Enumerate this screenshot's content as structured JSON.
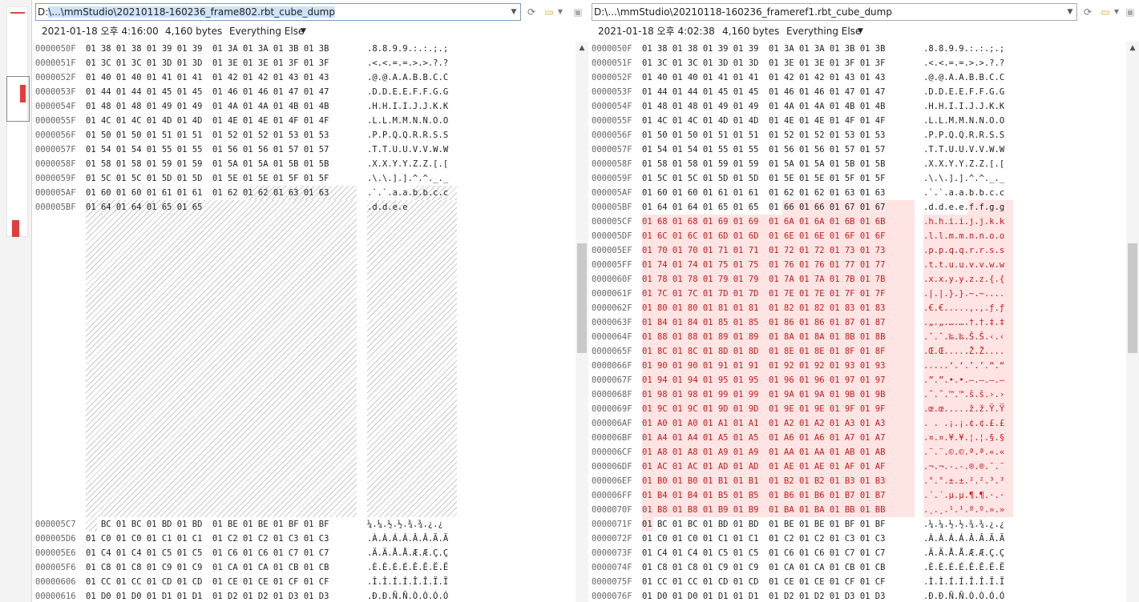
{
  "left_pane": {
    "path": "D:\\...\\mmStudio\\20210118-160236_frame802.rbt_cube_dump",
    "path_prefix": "D:",
    "path_rest": "\\...\\mmStudio\\20210118-160236_frame802.rbt_cube_dump",
    "date": "2021-01-18 오후 4:16:00",
    "size": "4,160 bytes",
    "filter": "Everything Else",
    "rows_top": [
      {
        "addr": "0000050F",
        "bytes": "01 38 01 38 01 39 01 39  01 3A 01 3A 01 3B 01 3B",
        "ascii": ".8.8.9.9.:.:.;.;"
      },
      {
        "addr": "0000051F",
        "bytes": "01 3C 01 3C 01 3D 01 3D  01 3E 01 3E 01 3F 01 3F",
        "ascii": ".<.<.=.=.>.>.?.?"
      },
      {
        "addr": "0000052F",
        "bytes": "01 40 01 40 01 41 01 41  01 42 01 42 01 43 01 43",
        "ascii": ".@.@.A.A.B.B.C.C"
      },
      {
        "addr": "0000053F",
        "bytes": "01 44 01 44 01 45 01 45  01 46 01 46 01 47 01 47",
        "ascii": ".D.D.E.E.F.F.G.G"
      },
      {
        "addr": "0000054F",
        "bytes": "01 48 01 48 01 49 01 49  01 4A 01 4A 01 4B 01 4B",
        "ascii": ".H.H.I.I.J.J.K.K"
      },
      {
        "addr": "0000055F",
        "bytes": "01 4C 01 4C 01 4D 01 4D  01 4E 01 4E 01 4F 01 4F",
        "ascii": ".L.L.M.M.N.N.O.O"
      },
      {
        "addr": "0000056F",
        "bytes": "01 50 01 50 01 51 01 51  01 52 01 52 01 53 01 53",
        "ascii": ".P.P.Q.Q.R.R.S.S"
      },
      {
        "addr": "0000057F",
        "bytes": "01 54 01 54 01 55 01 55  01 56 01 56 01 57 01 57",
        "ascii": ".T.T.U.U.V.V.W.W"
      },
      {
        "addr": "0000058F",
        "bytes": "01 58 01 58 01 59 01 59  01 5A 01 5A 01 5B 01 5B",
        "ascii": ".X.X.Y.Y.Z.Z.[.["
      },
      {
        "addr": "0000059F",
        "bytes": "01 5C 01 5C 01 5D 01 5D  01 5E 01 5E 01 5F 01 5F",
        "ascii": ".\\.\\.].].^.^._._"
      },
      {
        "addr": "000005AF",
        "bytes": "01 60 01 60 01 61 01 61  01 62 01 62 01 63 01 63",
        "ascii": ".`.`.a.a.b.b.c.c"
      },
      {
        "addr": "000005BF",
        "bytes": "01 64 01 64 01 65 01 65",
        "ascii": ".d.d.e.e"
      }
    ],
    "rows_bottom": [
      {
        "addr": "000005C7",
        "bytes": "   BC 01 BC 01 BD 01 BD  01 BE 01 BE 01 BF 01 BF",
        "ascii": "¼.¼.½.½.¾.¾.¿.¿"
      },
      {
        "addr": "000005D6",
        "bytes": "01 C0 01 C0 01 C1 01 C1  01 C2 01 C2 01 C3 01 C3",
        "ascii": ".À.À.Á.Á.Â.Â.Ã.Ã"
      },
      {
        "addr": "000005E6",
        "bytes": "01 C4 01 C4 01 C5 01 C5  01 C6 01 C6 01 C7 01 C7",
        "ascii": ".Ä.Ä.Å.Å.Æ.Æ.Ç.Ç"
      },
      {
        "addr": "000005F6",
        "bytes": "01 C8 01 C8 01 C9 01 C9  01 CA 01 CA 01 CB 01 CB",
        "ascii": ".È.È.É.É.Ê.Ê.Ë.Ë"
      },
      {
        "addr": "00000606",
        "bytes": "01 CC 01 CC 01 CD 01 CD  01 CE 01 CE 01 CF 01 CF",
        "ascii": ".Ì.Ì.Í.Í.Î.Î.Ï.Ï"
      },
      {
        "addr": "00000616",
        "bytes": "01 D0 01 D0 01 D1 01 D1  01 D2 01 D2 01 D3 01 D3",
        "ascii": ".Ð.Ð.Ñ.Ñ.Ò.Ò.Ó.Ó"
      }
    ]
  },
  "right_pane": {
    "path": "D:\\...\\mmStudio\\20210118-160236_frameref1.rbt_cube_dump",
    "date": "2021-01-18 오후 4:02:38",
    "size": "4,160 bytes",
    "filter": "Everything Else",
    "rows": [
      {
        "addr": "0000050F",
        "bytes": "01 38 01 38 01 39 01 39  01 3A 01 3A 01 3B 01 3B",
        "ascii": ".8.8.9.9.:.:.;.;",
        "diff": false
      },
      {
        "addr": "0000051F",
        "bytes": "01 3C 01 3C 01 3D 01 3D  01 3E 01 3E 01 3F 01 3F",
        "ascii": ".<.<.=.=.>.>.?.?",
        "diff": false
      },
      {
        "addr": "0000052F",
        "bytes": "01 40 01 40 01 41 01 41  01 42 01 42 01 43 01 43",
        "ascii": ".@.@.A.A.B.B.C.C",
        "diff": false
      },
      {
        "addr": "0000053F",
        "bytes": "01 44 01 44 01 45 01 45  01 46 01 46 01 47 01 47",
        "ascii": ".D.D.E.E.F.F.G.G",
        "diff": false
      },
      {
        "addr": "0000054F",
        "bytes": "01 48 01 48 01 49 01 49  01 4A 01 4A 01 4B 01 4B",
        "ascii": ".H.H.I.I.J.J.K.K",
        "diff": false
      },
      {
        "addr": "0000055F",
        "bytes": "01 4C 01 4C 01 4D 01 4D  01 4E 01 4E 01 4F 01 4F",
        "ascii": ".L.L.M.M.N.N.O.O",
        "diff": false
      },
      {
        "addr": "0000056F",
        "bytes": "01 50 01 50 01 51 01 51  01 52 01 52 01 53 01 53",
        "ascii": ".P.P.Q.Q.R.R.S.S",
        "diff": false
      },
      {
        "addr": "0000057F",
        "bytes": "01 54 01 54 01 55 01 55  01 56 01 56 01 57 01 57",
        "ascii": ".T.T.U.U.V.V.W.W",
        "diff": false
      },
      {
        "addr": "0000058F",
        "bytes": "01 58 01 58 01 59 01 59  01 5A 01 5A 01 5B 01 5B",
        "ascii": ".X.X.Y.Y.Z.Z.[.[",
        "diff": false
      },
      {
        "addr": "0000059F",
        "bytes": "01 5C 01 5C 01 5D 01 5D  01 5E 01 5E 01 5F 01 5F",
        "ascii": ".\\.\\.].].^.^._._",
        "diff": false
      },
      {
        "addr": "000005AF",
        "bytes": "01 60 01 60 01 61 01 61  01 62 01 62 01 63 01 63",
        "ascii": ".`.`.a.a.b.b.c.c",
        "diff": false
      },
      {
        "addr": "000005BF",
        "bytes": "01 64 01 64 01 65 01 65  01 66 01 66 01 67 01 67",
        "ascii": ".d.d.e.e.f.f.g.g",
        "diff": "partial"
      },
      {
        "addr": "000005CF",
        "bytes": "01 68 01 68 01 69 01 69  01 6A 01 6A 01 6B 01 6B",
        "ascii": ".h.h.i.i.j.j.k.k",
        "diff": true
      },
      {
        "addr": "000005DF",
        "bytes": "01 6C 01 6C 01 6D 01 6D  01 6E 01 6E 01 6F 01 6F",
        "ascii": ".l.l.m.m.n.n.o.o",
        "diff": true
      },
      {
        "addr": "000005EF",
        "bytes": "01 70 01 70 01 71 01 71  01 72 01 72 01 73 01 73",
        "ascii": ".p.p.q.q.r.r.s.s",
        "diff": true
      },
      {
        "addr": "000005FF",
        "bytes": "01 74 01 74 01 75 01 75  01 76 01 76 01 77 01 77",
        "ascii": ".t.t.u.u.v.v.w.w",
        "diff": true
      },
      {
        "addr": "0000060F",
        "bytes": "01 78 01 78 01 79 01 79  01 7A 01 7A 01 7B 01 7B",
        "ascii": ".x.x.y.y.z.z.{.{",
        "diff": true
      },
      {
        "addr": "0000061F",
        "bytes": "01 7C 01 7C 01 7D 01 7D  01 7E 01 7E 01 7F 01 7F",
        "ascii": ".|.|.}.}.~.~....",
        "diff": true
      },
      {
        "addr": "0000062F",
        "bytes": "01 80 01 80 01 81 01 81  01 82 01 82 01 83 01 83",
        "ascii": ".€.€.....‚.‚.ƒ.ƒ",
        "diff": true
      },
      {
        "addr": "0000063F",
        "bytes": "01 84 01 84 01 85 01 85  01 86 01 86 01 87 01 87",
        "ascii": ".„.„.….….†.†.‡.‡",
        "diff": true
      },
      {
        "addr": "0000064F",
        "bytes": "01 88 01 88 01 89 01 89  01 8A 01 8A 01 8B 01 8B",
        "ascii": ".ˆ.ˆ.‰.‰.Š.Š.‹.‹",
        "diff": true
      },
      {
        "addr": "0000065F",
        "bytes": "01 8C 01 8C 01 8D 01 8D  01 8E 01 8E 01 8F 01 8F",
        "ascii": ".Œ.Œ.....Ž.Ž....",
        "diff": true
      },
      {
        "addr": "0000066F",
        "bytes": "01 90 01 90 01 91 01 91  01 92 01 92 01 93 01 93",
        "ascii": ".....‘.‘.’.’.“.“",
        "diff": true
      },
      {
        "addr": "0000067F",
        "bytes": "01 94 01 94 01 95 01 95  01 96 01 96 01 97 01 97",
        "ascii": ".”.”.•.•.–.–.—.—",
        "diff": true
      },
      {
        "addr": "0000068F",
        "bytes": "01 98 01 98 01 99 01 99  01 9A 01 9A 01 9B 01 9B",
        "ascii": ".˜.˜.™.™.š.š.›.›",
        "diff": true
      },
      {
        "addr": "0000069F",
        "bytes": "01 9C 01 9C 01 9D 01 9D  01 9E 01 9E 01 9F 01 9F",
        "ascii": ".œ.œ.....ž.ž.Ÿ.Ÿ",
        "diff": true
      },
      {
        "addr": "000006AF",
        "bytes": "01 A0 01 A0 01 A1 01 A1  01 A2 01 A2 01 A3 01 A3",
        "ascii": ". . .¡.¡.¢.¢.£.£",
        "diff": true
      },
      {
        "addr": "000006BF",
        "bytes": "01 A4 01 A4 01 A5 01 A5  01 A6 01 A6 01 A7 01 A7",
        "ascii": ".¤.¤.¥.¥.¦.¦.§.§",
        "diff": true
      },
      {
        "addr": "000006CF",
        "bytes": "01 A8 01 A8 01 A9 01 A9  01 AA 01 AA 01 AB 01 AB",
        "ascii": ".¨.¨.©.©.ª.ª.«.«",
        "diff": true
      },
      {
        "addr": "000006DF",
        "bytes": "01 AC 01 AC 01 AD 01 AD  01 AE 01 AE 01 AF 01 AF",
        "ascii": ".¬.¬.-.-.®.®.¯.¯",
        "diff": true
      },
      {
        "addr": "000006EF",
        "bytes": "01 B0 01 B0 01 B1 01 B1  01 B2 01 B2 01 B3 01 B3",
        "ascii": ".°.°.±.±.².².³.³",
        "diff": true
      },
      {
        "addr": "000006FF",
        "bytes": "01 B4 01 B4 01 B5 01 B5  01 B6 01 B6 01 B7 01 B7",
        "ascii": ".´.´.µ.µ.¶.¶.·.·",
        "diff": true
      },
      {
        "addr": "0000070F",
        "bytes": "01 B8 01 B8 01 B9 01 B9  01 BA 01 BA 01 BB 01 BB",
        "ascii": ".¸.¸.¹.¹.º.º.».»",
        "diff": true
      },
      {
        "addr": "0000071F",
        "bytes": "01 BC 01 BC 01 BD 01 BD  01 BE 01 BE 01 BF 01 BF",
        "ascii": ".¼.¼.½.½.¾.¾.¿.¿",
        "diff": "first"
      },
      {
        "addr": "0000072F",
        "bytes": "01 C0 01 C0 01 C1 01 C1  01 C2 01 C2 01 C3 01 C3",
        "ascii": ".À.À.Á.Á.Â.Â.Ã.Ã",
        "diff": false
      },
      {
        "addr": "0000073F",
        "bytes": "01 C4 01 C4 01 C5 01 C5  01 C6 01 C6 01 C7 01 C7",
        "ascii": ".Ä.Ä.Å.Å.Æ.Æ.Ç.Ç",
        "diff": false
      },
      {
        "addr": "0000074F",
        "bytes": "01 C8 01 C8 01 C9 01 C9  01 CA 01 CA 01 CB 01 CB",
        "ascii": ".È.È.É.É.Ê.Ê.Ë.Ë",
        "diff": false
      },
      {
        "addr": "0000075F",
        "bytes": "01 CC 01 CC 01 CD 01 CD  01 CE 01 CE 01 CF 01 CF",
        "ascii": ".Ì.Ì.Í.Í.Î.Î.Ï.Ï",
        "diff": false
      },
      {
        "addr": "0000076F",
        "bytes": "01 D0 01 D0 01 D1 01 D1  01 D2 01 D2 01 D3 01 D3",
        "ascii": ".Ð.Ð.Ñ.Ñ.Ò.Ò.Ó.Ó",
        "diff": false
      }
    ]
  },
  "icons": {
    "refresh": "refresh-icon",
    "open": "open-folder-icon",
    "save": "save-icon",
    "dropdown": "chevron-down-icon"
  },
  "colors": {
    "diff_text": "#c91818",
    "diff_bg": "#ffe4e4",
    "overview_mark": "#e43c3c"
  }
}
